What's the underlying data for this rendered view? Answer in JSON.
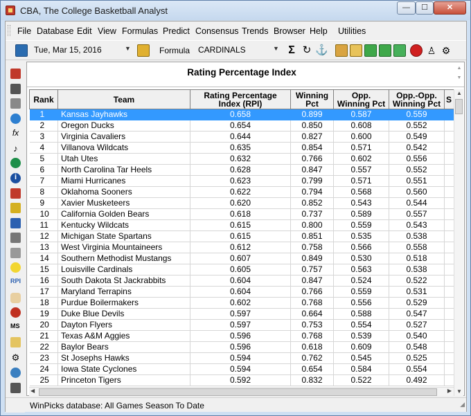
{
  "window": {
    "title": "CBA,  The College Basketball Analyst",
    "min_glyph": "—",
    "max_glyph": "☐",
    "close_glyph": "✕"
  },
  "menu": {
    "items": [
      "File",
      "Database",
      "Edit",
      "View",
      "Formulas",
      "Predict",
      "Consensus",
      "Trends",
      "Browser",
      "Help",
      "Utilities"
    ]
  },
  "toolbar": {
    "date": "Tue, Mar 15, 2016",
    "formula_label": "Formula",
    "formula_value": "CARDINALS"
  },
  "panel": {
    "title": "Rating Percentage Index"
  },
  "table": {
    "columns": [
      "Rank",
      "Team",
      "Rating Percentage Index (RPI)",
      "Winning Pct",
      "Opp. Winning Pct",
      "Opp.-Opp. Winning Pct",
      "S S"
    ],
    "rows": [
      {
        "rank": "1",
        "team": "Kansas Jayhawks",
        "rpi": "0.658",
        "wp": "0.899",
        "owp": "0.587",
        "oowp": "0.559"
      },
      {
        "rank": "2",
        "team": "Oregon Ducks",
        "rpi": "0.654",
        "wp": "0.850",
        "owp": "0.608",
        "oowp": "0.552"
      },
      {
        "rank": "3",
        "team": "Virginia Cavaliers",
        "rpi": "0.644",
        "wp": "0.827",
        "owp": "0.600",
        "oowp": "0.549"
      },
      {
        "rank": "4",
        "team": "Villanova Wildcats",
        "rpi": "0.635",
        "wp": "0.854",
        "owp": "0.571",
        "oowp": "0.542"
      },
      {
        "rank": "5",
        "team": "Utah Utes",
        "rpi": "0.632",
        "wp": "0.766",
        "owp": "0.602",
        "oowp": "0.556"
      },
      {
        "rank": "6",
        "team": "North Carolina Tar Heels",
        "rpi": "0.628",
        "wp": "0.847",
        "owp": "0.557",
        "oowp": "0.552"
      },
      {
        "rank": "7",
        "team": "Miami Hurricanes",
        "rpi": "0.623",
        "wp": "0.799",
        "owp": "0.571",
        "oowp": "0.551"
      },
      {
        "rank": "8",
        "team": "Oklahoma Sooners",
        "rpi": "0.622",
        "wp": "0.794",
        "owp": "0.568",
        "oowp": "0.560"
      },
      {
        "rank": "9",
        "team": "Xavier Musketeers",
        "rpi": "0.620",
        "wp": "0.852",
        "owp": "0.543",
        "oowp": "0.544"
      },
      {
        "rank": "10",
        "team": "California Golden Bears",
        "rpi": "0.618",
        "wp": "0.737",
        "owp": "0.589",
        "oowp": "0.557"
      },
      {
        "rank": "11",
        "team": "Kentucky Wildcats",
        "rpi": "0.615",
        "wp": "0.800",
        "owp": "0.559",
        "oowp": "0.543"
      },
      {
        "rank": "12",
        "team": "Michigan State Spartans",
        "rpi": "0.615",
        "wp": "0.851",
        "owp": "0.535",
        "oowp": "0.538"
      },
      {
        "rank": "13",
        "team": "West Virginia Mountaineers",
        "rpi": "0.612",
        "wp": "0.758",
        "owp": "0.566",
        "oowp": "0.558"
      },
      {
        "rank": "14",
        "team": "Southern Methodist Mustangs",
        "rpi": "0.607",
        "wp": "0.849",
        "owp": "0.530",
        "oowp": "0.518"
      },
      {
        "rank": "15",
        "team": "Louisville Cardinals",
        "rpi": "0.605",
        "wp": "0.757",
        "owp": "0.563",
        "oowp": "0.538"
      },
      {
        "rank": "16",
        "team": "South Dakota St Jackrabbits",
        "rpi": "0.604",
        "wp": "0.847",
        "owp": "0.524",
        "oowp": "0.522"
      },
      {
        "rank": "17",
        "team": "Maryland Terrapins",
        "rpi": "0.604",
        "wp": "0.766",
        "owp": "0.559",
        "oowp": "0.531"
      },
      {
        "rank": "18",
        "team": "Purdue Boilermakers",
        "rpi": "0.602",
        "wp": "0.768",
        "owp": "0.556",
        "oowp": "0.529"
      },
      {
        "rank": "19",
        "team": "Duke Blue Devils",
        "rpi": "0.597",
        "wp": "0.664",
        "owp": "0.588",
        "oowp": "0.547"
      },
      {
        "rank": "20",
        "team": "Dayton Flyers",
        "rpi": "0.597",
        "wp": "0.753",
        "owp": "0.554",
        "oowp": "0.527"
      },
      {
        "rank": "21",
        "team": "Texas A&M Aggies",
        "rpi": "0.596",
        "wp": "0.768",
        "owp": "0.539",
        "oowp": "0.540"
      },
      {
        "rank": "22",
        "team": "Baylor Bears",
        "rpi": "0.596",
        "wp": "0.618",
        "owp": "0.609",
        "oowp": "0.548"
      },
      {
        "rank": "23",
        "team": "St Josephs Hawks",
        "rpi": "0.594",
        "wp": "0.762",
        "owp": "0.545",
        "oowp": "0.525"
      },
      {
        "rank": "24",
        "team": "Iowa State Cyclones",
        "rpi": "0.594",
        "wp": "0.654",
        "owp": "0.584",
        "oowp": "0.554"
      },
      {
        "rank": "25",
        "team": "Princeton Tigers",
        "rpi": "0.592",
        "wp": "0.832",
        "owp": "0.522",
        "oowp": "0.492"
      }
    ]
  },
  "status": {
    "text": "WinPicks database:  All Games Season To Date"
  },
  "toolbar_icons": [
    "calendar-icon",
    "calendar-next-icon",
    "sigma-icon",
    "refresh-icon",
    "anchor-icon",
    "home-icon",
    "open-folder-icon",
    "arrow-left-icon",
    "arrow-right-icon",
    "recycle-icon",
    "stop-icon",
    "person-icon",
    "settings-icon"
  ],
  "sidebar_icons": [
    "spreadsheet-icon",
    "list-icon",
    "document-icon",
    "globe-icon",
    "function-icon",
    "music-note-icon",
    "world-icon",
    "info-icon",
    "grid-red-icon",
    "grid-yellow-icon",
    "grid-blue-icon",
    "list-add-icon",
    "list-star-icon",
    "lightbulb-icon",
    "rpi-icon",
    "hand-icon",
    "ball-icon",
    "ms-icon",
    "notes-icon",
    "gear-icon",
    "magnifier-icon",
    "calculator-icon"
  ]
}
